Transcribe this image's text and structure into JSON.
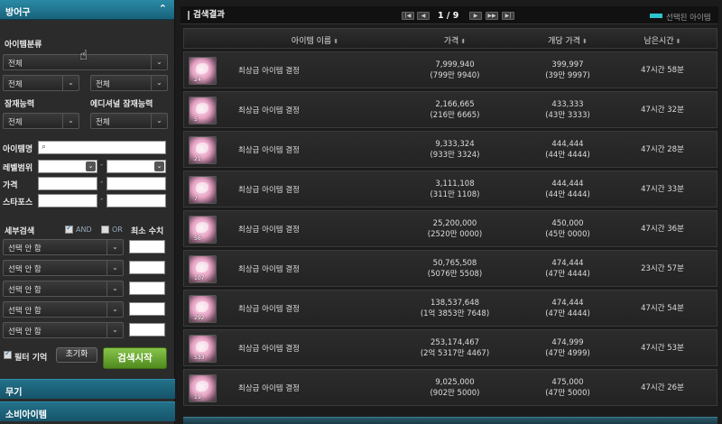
{
  "sidebar": {
    "category": "방어구",
    "item_class_label": "아이템분류",
    "item_class_value": "전체",
    "sub_class_left": "전체",
    "sub_class_right": "전체",
    "potential_label": "잠재능력",
    "potential_value": "전체",
    "additional_potential_label": "에디셔널 잠재능력",
    "additional_potential_value": "전체",
    "item_name_label": "아이템명",
    "level_label": "레벨범위",
    "price_label": "가격",
    "starforce_label": "스타포스",
    "detail_label": "세부검색",
    "and_label": "AND",
    "or_label": "OR",
    "min_label": "최소 수치",
    "option_placeholder": "선택 안 함",
    "options": [
      "선택 안 함",
      "선택 안 함",
      "선택 안 함",
      "선택 안 함",
      "선택 안 함"
    ],
    "filter_memory_label": "필터 기억",
    "reset_label": "초기화",
    "search_label": "검색시작",
    "weapon_category": "무기",
    "consumable_category": "소비아이템"
  },
  "results": {
    "title": "검색결과",
    "page": "1 / 9",
    "legend": "선택된 아이템",
    "columns": {
      "name": "아이템 이름",
      "price": "가격",
      "unit_price": "개당 가격",
      "time_left": "남은시간"
    },
    "rows": [
      {
        "qty": "24",
        "name": "최상급 아이템 결정",
        "price": "7,999,940",
        "price_sub": "(799만 9940)",
        "unit": "399,997",
        "unit_sub": "(39만 9997)",
        "time": "47시간 58분"
      },
      {
        "qty": "5",
        "name": "최상급 아이템 결정",
        "price": "2,166,665",
        "price_sub": "(216만 6665)",
        "unit": "433,333",
        "unit_sub": "(43만 3333)",
        "time": "47시간 32분"
      },
      {
        "qty": "21",
        "name": "최상급 아이템 결정",
        "price": "9,333,324",
        "price_sub": "(933만 3324)",
        "unit": "444,444",
        "unit_sub": "(44만 4444)",
        "time": "47시간 28분"
      },
      {
        "qty": "7",
        "name": "최상급 아이템 결정",
        "price": "3,111,108",
        "price_sub": "(311만 1108)",
        "unit": "444,444",
        "unit_sub": "(44만 4444)",
        "time": "47시간 33분"
      },
      {
        "qty": "56",
        "name": "최상급 아이템 결정",
        "price": "25,200,000",
        "price_sub": "(2520만 0000)",
        "unit": "450,000",
        "unit_sub": "(45만 0000)",
        "time": "47시간 36분"
      },
      {
        "qty": "107",
        "name": "최상급 아이템 결정",
        "price": "50,765,508",
        "price_sub": "(5076만 5508)",
        "unit": "474,444",
        "unit_sub": "(47만 4444)",
        "time": "23시간 57분"
      },
      {
        "qty": "292",
        "name": "최상급 아이템 결정",
        "price": "138,537,648",
        "price_sub": "(1억 3853만 7648)",
        "unit": "474,444",
        "unit_sub": "(47만 4444)",
        "time": "47시간 54분"
      },
      {
        "qty": "533",
        "name": "최상급 아이템 결정",
        "price": "253,174,467",
        "price_sub": "(2억 5317만 4467)",
        "unit": "474,999",
        "unit_sub": "(47만 4999)",
        "time": "47시간 53분"
      },
      {
        "qty": "19",
        "name": "최상급 아이템 결정",
        "price": "9,025,000",
        "price_sub": "(902만 5000)",
        "unit": "475,000",
        "unit_sub": "(47만 5000)",
        "time": "47시간 26분"
      }
    ]
  },
  "colors": {
    "accent_teal": "#2a8aa6",
    "search_green": "#6aa832",
    "selected_legend": "#2ec4ce"
  }
}
